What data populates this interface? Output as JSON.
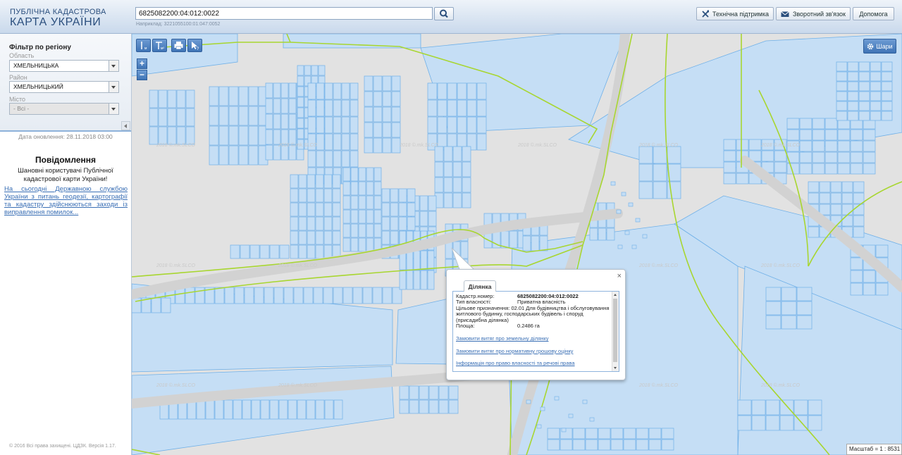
{
  "app": {
    "title_line1": "ПУБЛІЧНА КАДАСТРОВА",
    "title_line2": "КАРТА УКРАЇНИ"
  },
  "search": {
    "value": "6825082200:04:012:0022",
    "hint": "Наприклад: 3221055100:01:047:0052",
    "button_icon": "search-icon"
  },
  "header_buttons": [
    {
      "label": "Технічна підтримка",
      "icon": "tools-icon"
    },
    {
      "label": "Зворотний зв'язок",
      "icon": "envelope-icon"
    },
    {
      "label": "Допомога",
      "icon": ""
    }
  ],
  "filter": {
    "title": "Фільтр по регіону",
    "oblast_label": "Область",
    "oblast_value": "ХМЕЛЬНИЦЬКА",
    "raion_label": "Район",
    "raion_value": "ХМЕЛЬНИЦЬКИЙ",
    "misto_label": "Місто",
    "misto_value": "- Всі -"
  },
  "updated": "Дата оновлення: 28.11.2018 03:00",
  "notice": {
    "title": "Повідомлення",
    "text": "Шановні користувачі Публічної кадастрової карти України!",
    "link": "На сьогодні Державною службою України з питань геодезії, картографії та кадастру здійснюються заходи із виправлення помилок..."
  },
  "copyright": "© 2016 Всі права захищені. ЦДЗК. Версія 1.17.",
  "map": {
    "layers_label": "Шари",
    "watermark": "2018 ©.mk.SLCO",
    "scale": "Масштаб = 1 : 8531",
    "colors": {
      "background": "#e2e2e2",
      "parcel_fill": "#c5def5",
      "parcel_stroke": "#6fb0e8",
      "boundary": "#a8d630"
    }
  },
  "popup": {
    "tab": "Ділянка",
    "kadastr_label": "Кадастр.номер:",
    "kadastr_value": "6825082200:04:012:0022",
    "vlasnist_label": "Тип власності:",
    "vlasnist_value": "Приватна власність",
    "pryznach_label": "Цільове призначення:",
    "pryznach_value": "02.01 Для будівництва і обслуговування житлового будинку, господарських будівель і споруд (присадибна ділянка)",
    "ploshcha_label": "Площа:",
    "ploshcha_value": "0.2486 га",
    "links": [
      "Замовити витяг про земельну ділянку",
      "Замовити витяг про нормативну грошову оцінку",
      "Інформація про право власності та речові права"
    ]
  }
}
